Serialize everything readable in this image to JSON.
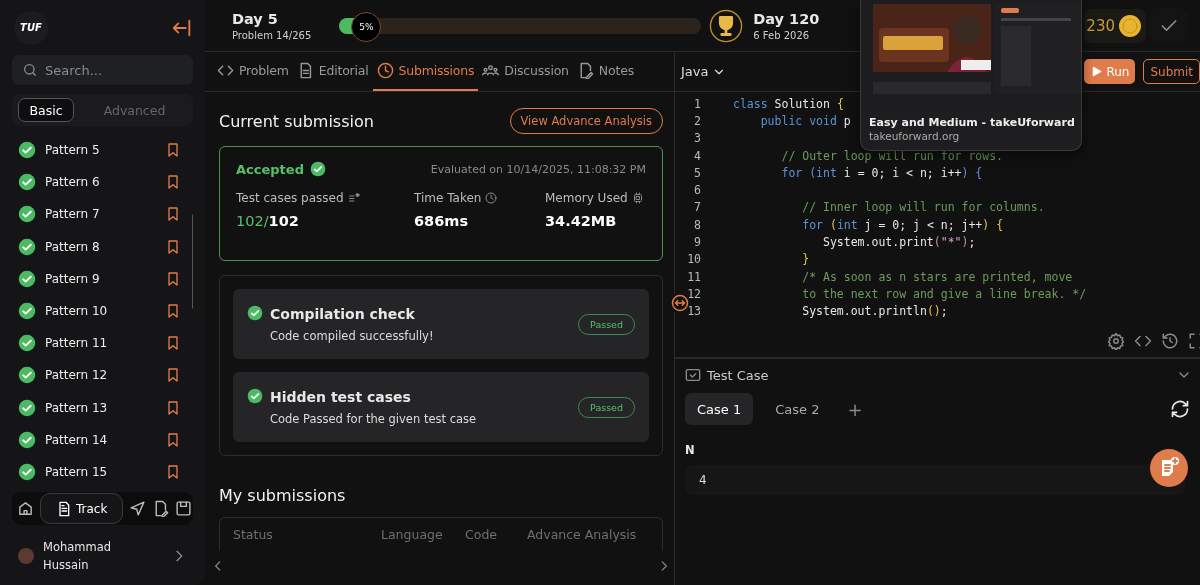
{
  "sidebar": {
    "logo": "TUF",
    "search": {
      "placeholder": "Search..."
    },
    "level_tabs": [
      {
        "label": "Basic",
        "selected": true
      },
      {
        "label": "Advanced",
        "selected": false
      }
    ],
    "problems": [
      {
        "title": "Pattern 5",
        "solved": true
      },
      {
        "title": "Pattern 6",
        "solved": true
      },
      {
        "title": "Pattern 7",
        "solved": true
      },
      {
        "title": "Pattern 8",
        "solved": true
      },
      {
        "title": "Pattern 9",
        "solved": true
      },
      {
        "title": "Pattern 10",
        "solved": true
      },
      {
        "title": "Pattern 11",
        "solved": true
      },
      {
        "title": "Pattern 12",
        "solved": true
      },
      {
        "title": "Pattern 13",
        "solved": true
      },
      {
        "title": "Pattern 14",
        "solved": true
      },
      {
        "title": "Pattern 15",
        "solved": true
      }
    ],
    "nav": [
      {
        "kind": "home",
        "selected": false
      },
      {
        "kind": "track",
        "label": "Track",
        "selected": true
      },
      {
        "kind": "send",
        "selected": false
      },
      {
        "kind": "file",
        "selected": false
      },
      {
        "kind": "save",
        "selected": false
      }
    ],
    "user": {
      "name": "Mohammad Hussain"
    }
  },
  "header": {
    "day": "Day 5",
    "problem": "Problem 14/265",
    "progress": {
      "label": "5%",
      "level": 0.05
    },
    "goal_day": "Day 120",
    "goal_date": "6 Feb 2026",
    "coins": "230"
  },
  "tabs": [
    {
      "kind": "code",
      "label": "Problem",
      "selected": false
    },
    {
      "kind": "doc",
      "label": "Editorial",
      "selected": false
    },
    {
      "kind": "clock",
      "label": "Submissions",
      "selected": true
    },
    {
      "kind": "people",
      "label": "Discussion",
      "selected": false
    },
    {
      "kind": "note",
      "label": "Notes",
      "selected": false
    }
  ],
  "submission": {
    "heading": "Current submission",
    "analysis_button": "View Advance Analysis",
    "status": "Accepted",
    "evaluated": "Evaluated on 10/14/2025, 11:08:32 PM",
    "stats": [
      {
        "kind": "tests",
        "label": "Test cases passed",
        "passed": "102/",
        "total": "102"
      },
      {
        "kind": "time",
        "label": "Time Taken",
        "total": "686ms"
      },
      {
        "kind": "memory",
        "label": "Memory Used",
        "total": "34.42MB"
      }
    ],
    "checks": [
      {
        "title": "Compilation check",
        "detail": "Code compiled successfully!",
        "badge": "Passed",
        "passed": true
      },
      {
        "title": "Hidden test cases",
        "detail": "Code Passed for the given test case",
        "badge": "Passed",
        "passed": true
      }
    ]
  },
  "my_submissions": {
    "heading": "My submissions",
    "columns": [
      "Status",
      "Language",
      "Code",
      "Advance Analysis"
    ]
  },
  "editor": {
    "language": "Java",
    "run": "Run",
    "submit": "Submit",
    "lines": [
      {
        "n": "1",
        "seg": [
          {
            "kind": "keyword",
            "text": "class"
          },
          {
            "kind": "plain",
            "text": " Solution "
          },
          {
            "kind": "brace",
            "text": "{"
          }
        ]
      },
      {
        "n": "2",
        "seg": [
          {
            "kind": "keyword",
            "text": "    public void"
          },
          {
            "kind": "plain",
            "text": " p"
          }
        ]
      },
      {
        "n": "3"
      },
      {
        "n": "4",
        "seg": [
          {
            "kind": "comment",
            "text": "       // Outer loop will run for rows."
          }
        ]
      },
      {
        "n": "5",
        "seg": [
          {
            "kind": "keyword",
            "text": "       for (int"
          },
          {
            "kind": "plain",
            "text": " i = 0; i < n; i++"
          },
          {
            "kind": "keyword",
            "text": ") {"
          }
        ]
      },
      {
        "n": "6"
      },
      {
        "n": "7",
        "seg": [
          {
            "kind": "comment",
            "text": "          // Inner loop will run for columns."
          }
        ]
      },
      {
        "n": "8",
        "seg": [
          {
            "kind": "keyword",
            "text": "          for"
          },
          {
            "kind": "brace",
            "text": " ("
          },
          {
            "kind": "keyword",
            "text": "int"
          },
          {
            "kind": "plain",
            "text": " j = 0; j < n; j++"
          },
          {
            "kind": "brace",
            "text": ") {"
          }
        ]
      },
      {
        "n": "9",
        "seg": [
          {
            "kind": "plain",
            "text": "             System.out.print"
          },
          {
            "kind": "punct",
            "text": "("
          },
          {
            "kind": "string",
            "text": "\"*\""
          },
          {
            "kind": "punct",
            "text": ")"
          },
          {
            "kind": "plain",
            "text": ";"
          }
        ]
      },
      {
        "n": "10",
        "seg": [
          {
            "kind": "brace",
            "text": "          }"
          }
        ]
      },
      {
        "n": "11",
        "seg": [
          {
            "kind": "comment",
            "text": "          /* As soon as n stars are printed, move"
          }
        ]
      },
      {
        "n": "12",
        "seg": [
          {
            "kind": "comment",
            "text": "          to the next row and give a line break. */"
          }
        ]
      },
      {
        "n": "13",
        "seg": [
          {
            "kind": "plain",
            "text": "          System.out.println"
          },
          {
            "kind": "brace",
            "text": "()"
          },
          {
            "kind": "plain",
            "text": ";"
          }
        ]
      }
    ]
  },
  "testcase": {
    "title": "Test Case",
    "cases": [
      {
        "label": "Case 1",
        "selected": true
      },
      {
        "label": "Case 2",
        "selected": false
      }
    ],
    "add": "+",
    "input_label": "N",
    "input_value": "4"
  },
  "preview": {
    "kind": "picture",
    "title": "Easy and Medium - takeUforward",
    "url": "takeuforward.org"
  }
}
